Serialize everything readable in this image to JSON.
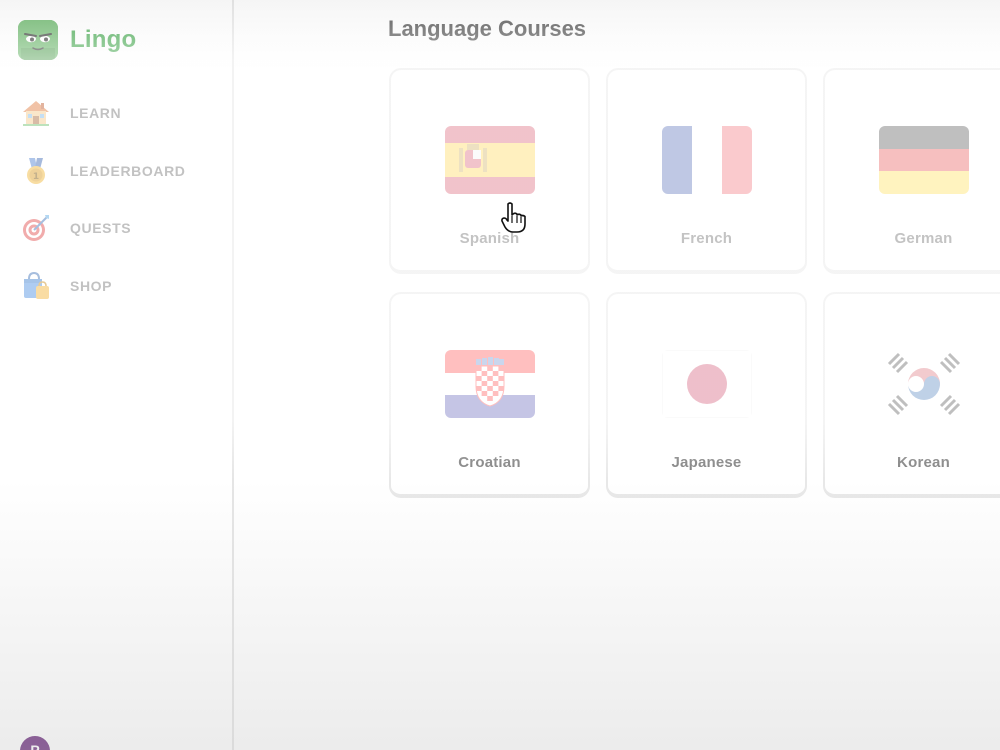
{
  "app": {
    "name": "Lingo",
    "brand_color": "#3aa345"
  },
  "sidebar": {
    "items": [
      {
        "label": "LEARN",
        "icon": "house-icon"
      },
      {
        "label": "LEADERBOARD",
        "icon": "medal-icon"
      },
      {
        "label": "QUESTS",
        "icon": "target-icon"
      },
      {
        "label": "SHOP",
        "icon": "shopping-bag-icon"
      }
    ],
    "avatar_initial": "P"
  },
  "main": {
    "title": "Language Courses",
    "courses": [
      {
        "name": "Spanish",
        "flag": "spain-flag-icon"
      },
      {
        "name": "French",
        "flag": "france-flag-icon"
      },
      {
        "name": "German",
        "flag": "germany-flag-icon"
      },
      {
        "name": "Croatian",
        "flag": "croatia-flag-icon"
      },
      {
        "name": "Japanese",
        "flag": "japan-flag-icon"
      },
      {
        "name": "Korean",
        "flag": "korea-flag-icon"
      }
    ]
  }
}
